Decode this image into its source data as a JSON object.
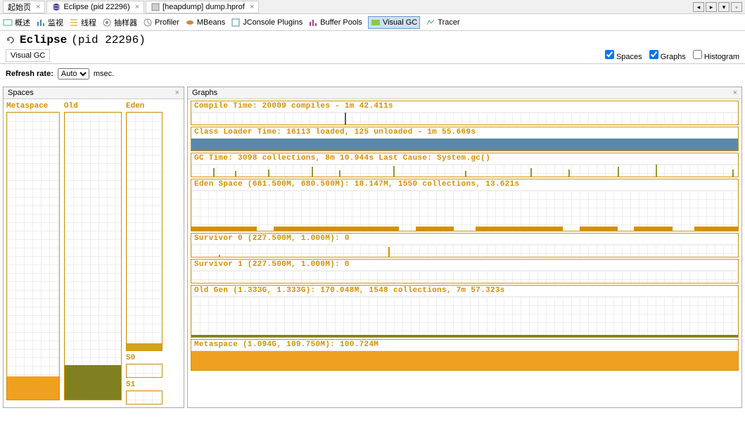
{
  "tabs": [
    {
      "label": "起始页",
      "active": false
    },
    {
      "label": "Eclipse (pid 22296)",
      "active": true
    },
    {
      "label": "[heapdump] dump.hprof",
      "active": false
    }
  ],
  "toolbar": [
    {
      "label": "概述"
    },
    {
      "label": "监视"
    },
    {
      "label": "线程"
    },
    {
      "label": "抽样器"
    },
    {
      "label": "Profiler"
    },
    {
      "label": "MBeans"
    },
    {
      "label": "JConsole Plugins"
    },
    {
      "label": "Buffer Pools"
    },
    {
      "label": "Visual GC"
    },
    {
      "label": "Tracer"
    }
  ],
  "title": {
    "name": "Eclipse",
    "pid": "(pid 22296)"
  },
  "subtab": "Visual GC",
  "checks": {
    "spaces": "Spaces",
    "graphs": "Graphs",
    "histogram": "Histogram"
  },
  "refresh": {
    "label": "Refresh rate:",
    "value": "Auto",
    "unit": "msec."
  },
  "spaces": {
    "title": "Spaces",
    "metaspace": "Metaspace",
    "old": "Old",
    "eden": "Eden",
    "s0": "S0",
    "s1": "S1"
  },
  "graphs": {
    "title": "Graphs",
    "compile": "Compile Time: 20009 compiles - 1m 42.411s",
    "classloader": "Class Loader Time: 16113 loaded, 125 unloaded - 1m 55.669s",
    "gctime": "GC Time: 3098 collections, 8m 10.944s  Last Cause: System.gc()",
    "eden": "Eden Space (681.500M, 680.500M): 18.147M, 1550 collections, 13.621s",
    "survivor0": "Survivor 0 (227.500M, 1.000M): 0",
    "survivor1": "Survivor 1 (227.500M, 1.000M): 0",
    "oldgen": "Old Gen (1.333G, 1.333G): 170.048M, 1548 collections, 7m 57.323s",
    "metaspace": "Metaspace (1.094G, 109.750M): 100.724M"
  },
  "chart_data": {
    "type": "bar",
    "spaces": {
      "metaspace_fill_pct": 8,
      "metaspace_color": "#f0a020",
      "old_fill_pct": 12,
      "old_color": "#808020",
      "eden_fill_pct": 3,
      "eden_color": "#d4a020",
      "s0_fill_pct": 0,
      "s1_fill_pct": 0
    },
    "graphs": {
      "compile_spike_at_pct": 28,
      "gc_spikes_pct": [
        4,
        8,
        14,
        22,
        27,
        37,
        50,
        62,
        69,
        78,
        85,
        99
      ],
      "eden_bands": [
        [
          0,
          12
        ],
        [
          15,
          38
        ],
        [
          41,
          48
        ],
        [
          52,
          68
        ],
        [
          71,
          78
        ],
        [
          81,
          88
        ],
        [
          92,
          100
        ]
      ],
      "survivor0_spike_at_pct": 36,
      "oldgen_fill_pct": 6,
      "metaspace_fill_pct": 100
    }
  }
}
